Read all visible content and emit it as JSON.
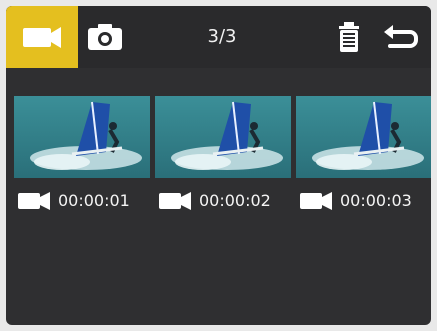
{
  "toolbar": {
    "video_tab_icon": "video-camera-icon",
    "photo_tab_icon": "camera-icon",
    "counter": "3/3",
    "delete_icon": "trash-icon",
    "back_icon": "return-arrow-icon",
    "accent_color": "#e4bf1f"
  },
  "gallery": {
    "items": [
      {
        "icon": "video-camera-icon",
        "duration": "00:00:01"
      },
      {
        "icon": "video-camera-icon",
        "duration": "00:00:02"
      },
      {
        "icon": "video-camera-icon",
        "duration": "00:00:03"
      }
    ]
  }
}
